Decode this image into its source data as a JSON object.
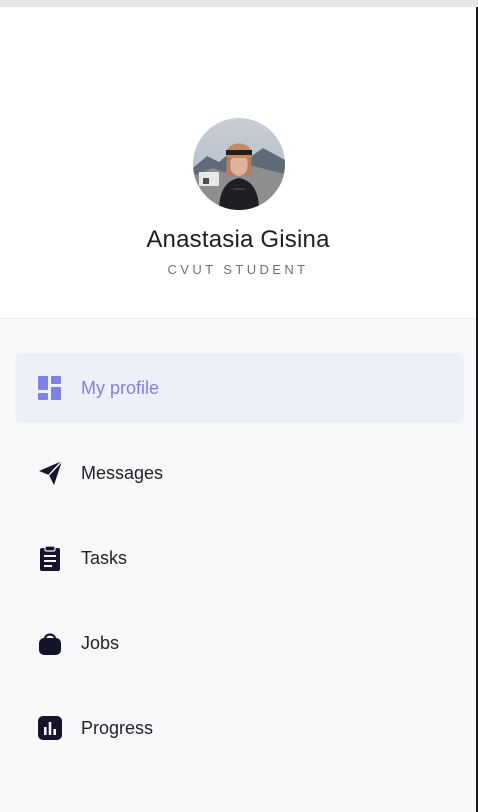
{
  "profile": {
    "name": "Anastasia Gisina",
    "role": "CVUT STUDENT",
    "avatar_icon": "user-photo"
  },
  "menu": {
    "items": [
      {
        "label": "My profile",
        "icon": "dashboard-icon",
        "active": true
      },
      {
        "label": "Messages",
        "icon": "send-icon",
        "active": false
      },
      {
        "label": "Tasks",
        "icon": "clipboard-icon",
        "active": false
      },
      {
        "label": "Jobs",
        "icon": "bag-icon",
        "active": false
      },
      {
        "label": "Progress",
        "icon": "bar-chart-icon",
        "active": false
      }
    ]
  },
  "colors": {
    "accent": "#8182dd",
    "active_background": "#eef0f9",
    "icon_dark": "#14142b",
    "menu_background": "#f8f8fb"
  }
}
